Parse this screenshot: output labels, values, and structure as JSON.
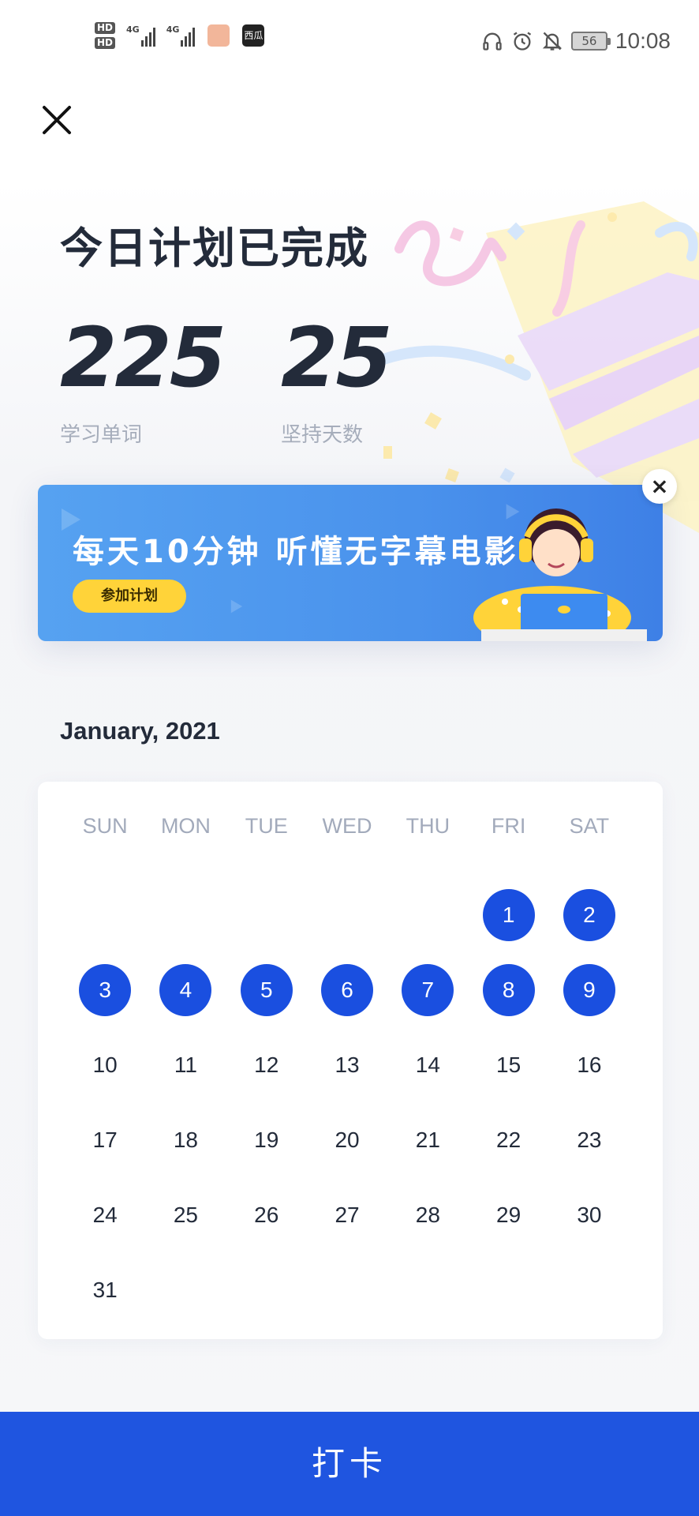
{
  "status_bar": {
    "hd1": "HD",
    "hd2": "HD",
    "sig1_label": "4G",
    "sig2_label": "4G",
    "app_label": "西瓜",
    "battery": "56",
    "time": "10:08"
  },
  "header": {
    "title": "今日计划已完成",
    "stats": [
      {
        "value": "225",
        "label": "学习单词"
      },
      {
        "value": "25",
        "label": "坚持天数"
      }
    ]
  },
  "banner": {
    "text": "每天10分钟 听懂无字幕电影",
    "button": "参加计划",
    "close": "×"
  },
  "calendar": {
    "month": "January, 2021",
    "weekdays": [
      "SUN",
      "MON",
      "TUE",
      "WED",
      "THU",
      "FRI",
      "SAT"
    ],
    "first_weekday_index": 5,
    "days_in_month": 31,
    "completed_days": [
      1,
      2,
      3,
      4,
      5,
      6,
      7,
      8,
      9
    ]
  },
  "footer": {
    "punch_button": "打卡"
  },
  "colors": {
    "primary": "#1f55e0",
    "completed_day": "#1a4fe0",
    "banner_button": "#ffd339",
    "title": "#232b3a",
    "muted": "#a6adbb"
  },
  "icons": {
    "close": "close-icon",
    "headphone": "headphone-icon",
    "alarm": "alarm-icon",
    "mute": "bell-mute-icon"
  }
}
